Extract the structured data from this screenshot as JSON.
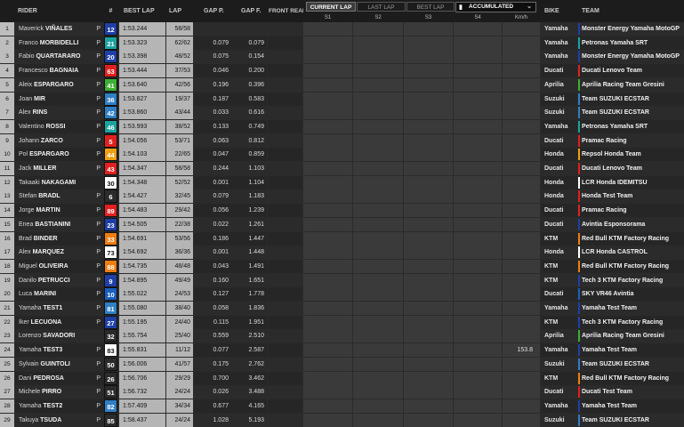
{
  "header": {
    "pos": "",
    "rider": "RIDER",
    "num": "#",
    "best_lap": "BEST LAP",
    "lap": "LAP",
    "gap_p": "GAP P.",
    "gap_f": "GAP F.",
    "front_rear": "FRONT REAR",
    "current_lap": "CURRENT LAP",
    "last_lap": "LAST LAP",
    "best_lap_btn": "BEST LAP",
    "accumulated": "ACCUMULATED",
    "s1": "S1",
    "s2": "S2",
    "s3": "S3",
    "s4": "S4",
    "kmh": "Km/h",
    "bike": "BIKE",
    "team": "TEAM"
  },
  "colors": {
    "yamaha_factory": "#1e3fa8",
    "petronas": "#1aa3a0",
    "ducati": "#e0201f",
    "aprilia": "#3cb034",
    "suzuki": "#2f7fc4",
    "honda": "#e0201f",
    "ktm": "#f07d10",
    "white": "#ffffff",
    "vr46": "#1a5fbf"
  },
  "riders": [
    {
      "pos": "1",
      "first": "Maverick",
      "last": "VIÑALES",
      "p": "P",
      "num": "12",
      "num_bg": "#1e3fa8",
      "num_fg": "#ffffff",
      "best": "1:53.244",
      "lap": "58/58",
      "gap_p": "",
      "gap_f": "",
      "kmh": "",
      "bike": "Yamaha",
      "team": "Monster Energy Yamaha MotoGP",
      "team_color": "#1e3fa8"
    },
    {
      "pos": "2",
      "first": "Franco",
      "last": "MORBIDELLI",
      "p": "P",
      "num": "21",
      "num_bg": "#1aa3a0",
      "num_fg": "#ffffff",
      "best": "1:53.323",
      "lap": "62/62",
      "gap_p": "0.079",
      "gap_f": "0.079",
      "kmh": "",
      "bike": "Yamaha",
      "team": "Petronas Yamaha SRT",
      "team_color": "#1aa3a0"
    },
    {
      "pos": "3",
      "first": "Fabio",
      "last": "QUARTARARO",
      "p": "P",
      "num": "20",
      "num_bg": "#1e3fa8",
      "num_fg": "#ffffff",
      "best": "1:53.398",
      "lap": "48/52",
      "gap_p": "0.075",
      "gap_f": "0.154",
      "kmh": "",
      "bike": "Yamaha",
      "team": "Monster Energy Yamaha MotoGP",
      "team_color": "#1e3fa8"
    },
    {
      "pos": "4",
      "first": "Francesco",
      "last": "BAGNAIA",
      "p": "P",
      "num": "63",
      "num_bg": "#e0201f",
      "num_fg": "#ffffff",
      "best": "1:53.444",
      "lap": "37/53",
      "gap_p": "0.046",
      "gap_f": "0.200",
      "kmh": "",
      "bike": "Ducati",
      "team": "Ducati Lenovo Team",
      "team_color": "#e0201f"
    },
    {
      "pos": "5",
      "first": "Aleix",
      "last": "ESPARGARO",
      "p": "P",
      "num": "41",
      "num_bg": "#3cb034",
      "num_fg": "#ffffff",
      "best": "1:53.640",
      "lap": "42/56",
      "gap_p": "0.196",
      "gap_f": "0.396",
      "kmh": "",
      "bike": "Aprilia",
      "team": "Aprilia Racing Team Gresini",
      "team_color": "#3cb034"
    },
    {
      "pos": "6",
      "first": "Joan",
      "last": "MIR",
      "p": "P",
      "num": "36",
      "num_bg": "#2f7fc4",
      "num_fg": "#ffffff",
      "best": "1:53.827",
      "lap": "19/37",
      "gap_p": "0.187",
      "gap_f": "0.583",
      "kmh": "",
      "bike": "Suzuki",
      "team": "Team SUZUKI ECSTAR",
      "team_color": "#2f7fc4"
    },
    {
      "pos": "7",
      "first": "Alex",
      "last": "RINS",
      "p": "P",
      "num": "42",
      "num_bg": "#2f7fc4",
      "num_fg": "#ffffff",
      "best": "1:53.860",
      "lap": "43/44",
      "gap_p": "0.033",
      "gap_f": "0.616",
      "kmh": "",
      "bike": "Suzuki",
      "team": "Team SUZUKI ECSTAR",
      "team_color": "#2f7fc4"
    },
    {
      "pos": "8",
      "first": "Valentino",
      "last": "ROSSI",
      "p": "P",
      "num": "46",
      "num_bg": "#1aa3a0",
      "num_fg": "#ffffff",
      "best": "1:53.993",
      "lap": "38/52",
      "gap_p": "0.133",
      "gap_f": "0.749",
      "kmh": "",
      "bike": "Yamaha",
      "team": "Petronas Yamaha SRT",
      "team_color": "#1aa3a0"
    },
    {
      "pos": "9",
      "first": "Johann",
      "last": "ZARCO",
      "p": "P",
      "num": "5",
      "num_bg": "#e0201f",
      "num_fg": "#ffffff",
      "best": "1:54.056",
      "lap": "53/71",
      "gap_p": "0.063",
      "gap_f": "0.812",
      "kmh": "",
      "bike": "Ducati",
      "team": "Pramac Racing",
      "team_color": "#e0201f"
    },
    {
      "pos": "10",
      "first": "Pol",
      "last": "ESPARGARO",
      "p": "P",
      "num": "44",
      "num_bg": "#f0a010",
      "num_fg": "#ffffff",
      "best": "1:54.103",
      "lap": "22/65",
      "gap_p": "0.047",
      "gap_f": "0.859",
      "kmh": "",
      "bike": "Honda",
      "team": "Repsol Honda Team",
      "team_color": "#f0a010"
    },
    {
      "pos": "11",
      "first": "Jack",
      "last": "MILLER",
      "p": "P",
      "num": "43",
      "num_bg": "#e0201f",
      "num_fg": "#ffffff",
      "best": "1:54.347",
      "lap": "58/58",
      "gap_p": "0.244",
      "gap_f": "1.103",
      "kmh": "",
      "bike": "Ducati",
      "team": "Ducati Lenovo Team",
      "team_color": "#e0201f"
    },
    {
      "pos": "12",
      "first": "Takaaki",
      "last": "NAKAGAMI",
      "p": "",
      "num": "30",
      "num_bg": "#ffffff",
      "num_fg": "#111111",
      "best": "1:54.348",
      "lap": "52/52",
      "gap_p": "0.001",
      "gap_f": "1.104",
      "kmh": "",
      "bike": "Honda",
      "team": "LCR Honda IDEMITSU",
      "team_color": "#ffffff"
    },
    {
      "pos": "13",
      "first": "Stefan",
      "last": "BRADL",
      "p": "P",
      "num": "6",
      "num_bg": "#2b2b2b",
      "num_fg": "#ffffff",
      "best": "1:54.427",
      "lap": "32/45",
      "gap_p": "0.079",
      "gap_f": "1.183",
      "kmh": "",
      "bike": "Honda",
      "team": "Honda Test Team",
      "team_color": "#e0201f"
    },
    {
      "pos": "14",
      "first": "Jorge",
      "last": "MARTIN",
      "p": "P",
      "num": "89",
      "num_bg": "#e0201f",
      "num_fg": "#ffffff",
      "best": "1:54.483",
      "lap": "29/42",
      "gap_p": "0.056",
      "gap_f": "1.239",
      "kmh": "",
      "bike": "Ducati",
      "team": "Pramac Racing",
      "team_color": "#e0201f"
    },
    {
      "pos": "15",
      "first": "Enea",
      "last": "BASTIANINI",
      "p": "P",
      "num": "23",
      "num_bg": "#1e3fa8",
      "num_fg": "#ffffff",
      "best": "1:54.505",
      "lap": "22/38",
      "gap_p": "0.022",
      "gap_f": "1.261",
      "kmh": "",
      "bike": "Ducati",
      "team": "Avintia Esponsorama",
      "team_color": "#1e3fa8"
    },
    {
      "pos": "16",
      "first": "Brad",
      "last": "BINDER",
      "p": "P",
      "num": "33",
      "num_bg": "#f07d10",
      "num_fg": "#ffffff",
      "best": "1:54.691",
      "lap": "53/56",
      "gap_p": "0.186",
      "gap_f": "1.447",
      "kmh": "",
      "bike": "KTM",
      "team": "Red Bull KTM Factory Racing",
      "team_color": "#f07d10"
    },
    {
      "pos": "17",
      "first": "Alex",
      "last": "MARQUEZ",
      "p": "P",
      "num": "73",
      "num_bg": "#ffffff",
      "num_fg": "#111111",
      "best": "1:54.692",
      "lap": "36/36",
      "gap_p": "0.001",
      "gap_f": "1.448",
      "kmh": "",
      "bike": "Honda",
      "team": "LCR Honda CASTROL",
      "team_color": "#ffffff"
    },
    {
      "pos": "18",
      "first": "Miguel",
      "last": "OLIVEIRA",
      "p": "P",
      "num": "88",
      "num_bg": "#f07d10",
      "num_fg": "#ffffff",
      "best": "1:54.735",
      "lap": "48/48",
      "gap_p": "0.043",
      "gap_f": "1.491",
      "kmh": "",
      "bike": "KTM",
      "team": "Red Bull KTM Factory Racing",
      "team_color": "#f07d10"
    },
    {
      "pos": "19",
      "first": "Danilo",
      "last": "PETRUCCI",
      "p": "P",
      "num": "9",
      "num_bg": "#1e3fa8",
      "num_fg": "#ffffff",
      "best": "1:54.895",
      "lap": "49/49",
      "gap_p": "0.160",
      "gap_f": "1.651",
      "kmh": "",
      "bike": "KTM",
      "team": "Tech 3 KTM Factory Racing",
      "team_color": "#1e3fa8"
    },
    {
      "pos": "20",
      "first": "Luca",
      "last": "MARINI",
      "p": "P",
      "num": "10",
      "num_bg": "#1a5fbf",
      "num_fg": "#ffffff",
      "best": "1:55.022",
      "lap": "24/53",
      "gap_p": "0.127",
      "gap_f": "1.778",
      "kmh": "",
      "bike": "Ducati",
      "team": "SKY VR46 Avintia",
      "team_color": "#1a5fbf"
    },
    {
      "pos": "21",
      "first": "Yamaha",
      "last": "TEST1",
      "p": "P",
      "num": "81",
      "num_bg": "#2f7fc4",
      "num_fg": "#ffffff",
      "best": "1:55.080",
      "lap": "38/40",
      "gap_p": "0.058",
      "gap_f": "1.836",
      "kmh": "",
      "bike": "Yamaha",
      "team": "Yamaha Test Team",
      "team_color": "#1e3fa8"
    },
    {
      "pos": "22",
      "first": "Iker",
      "last": "LECUONA",
      "p": "P",
      "num": "27",
      "num_bg": "#1e3fa8",
      "num_fg": "#ffffff",
      "best": "1:55.195",
      "lap": "24/40",
      "gap_p": "0.115",
      "gap_f": "1.951",
      "kmh": "",
      "bike": "KTM",
      "team": "Tech 3 KTM Factory Racing",
      "team_color": "#1e3fa8"
    },
    {
      "pos": "23",
      "first": "Lorenzo",
      "last": "SAVADORI",
      "p": "",
      "num": "32",
      "num_bg": "#2b2b2b",
      "num_fg": "#ffffff",
      "best": "1:55.754",
      "lap": "25/40",
      "gap_p": "0.559",
      "gap_f": "2.510",
      "kmh": "",
      "bike": "Aprilia",
      "team": "Aprilia Racing Team Gresini",
      "team_color": "#3cb034"
    },
    {
      "pos": "24",
      "first": "Yamaha",
      "last": "TEST3",
      "p": "P",
      "num": "83",
      "num_bg": "#ffffff",
      "num_fg": "#111111",
      "best": "1:55.831",
      "lap": "11/12",
      "gap_p": "0.077",
      "gap_f": "2.587",
      "kmh": "153.8",
      "bike": "Yamaha",
      "team": "Yamaha Test Team",
      "team_color": "#1e3fa8"
    },
    {
      "pos": "25",
      "first": "Sylvain",
      "last": "GUINTOLI",
      "p": "P",
      "num": "50",
      "num_bg": "#2b2b2b",
      "num_fg": "#ffffff",
      "best": "1:56.006",
      "lap": "41/57",
      "gap_p": "0.175",
      "gap_f": "2.762",
      "kmh": "",
      "bike": "Suzuki",
      "team": "Team SUZUKI ECSTAR",
      "team_color": "#2f7fc4"
    },
    {
      "pos": "26",
      "first": "Dani",
      "last": "PEDROSA",
      "p": "P",
      "num": "26",
      "num_bg": "#2b2b2b",
      "num_fg": "#ffffff",
      "best": "1:56.706",
      "lap": "29/29",
      "gap_p": "0.700",
      "gap_f": "3.462",
      "kmh": "",
      "bike": "KTM",
      "team": "Red Bull KTM Factory Racing",
      "team_color": "#f07d10"
    },
    {
      "pos": "27",
      "first": "Michele",
      "last": "PIRRO",
      "p": "P",
      "num": "51",
      "num_bg": "#2b2b2b",
      "num_fg": "#ffffff",
      "best": "1:56.732",
      "lap": "24/24",
      "gap_p": "0.026",
      "gap_f": "3.488",
      "kmh": "",
      "bike": "Ducati",
      "team": "Ducati Test Team",
      "team_color": "#e0201f"
    },
    {
      "pos": "28",
      "first": "Yamaha",
      "last": "TEST2",
      "p": "P",
      "num": "82",
      "num_bg": "#2f7fc4",
      "num_fg": "#ffffff",
      "best": "1:57.409",
      "lap": "34/34",
      "gap_p": "0.677",
      "gap_f": "4.165",
      "kmh": "",
      "bike": "Yamaha",
      "team": "Yamaha Test Team",
      "team_color": "#1e3fa8"
    },
    {
      "pos": "29",
      "first": "Takuya",
      "last": "TSUDA",
      "p": "P",
      "num": "85",
      "num_bg": "#2b2b2b",
      "num_fg": "#ffffff",
      "best": "1:58.437",
      "lap": "24/24",
      "gap_p": "1.028",
      "gap_f": "5.193",
      "kmh": "",
      "bike": "Suzuki",
      "team": "Team SUZUKI ECSTAR",
      "team_color": "#2f7fc4"
    }
  ]
}
